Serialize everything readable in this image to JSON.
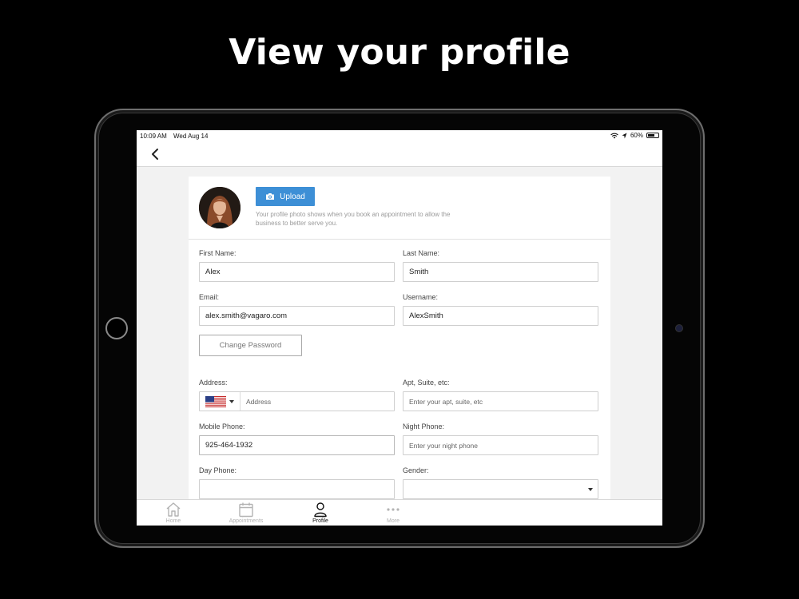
{
  "headline": "View your profile",
  "status_bar": {
    "time": "10:09 AM",
    "date": "Wed Aug 14",
    "battery": "60%"
  },
  "profile_photo": {
    "upload_label": "Upload",
    "hint": "Your profile photo shows when you book an appointment to allow the business to better serve you."
  },
  "form": {
    "first_name": {
      "label": "First Name:",
      "value": "Alex"
    },
    "last_name": {
      "label": "Last Name:",
      "value": "Smith"
    },
    "email": {
      "label": "Email:",
      "value": "alex.smith@vagaro.com"
    },
    "username": {
      "label": "Username:",
      "value": "AlexSmith"
    },
    "change_password": "Change Password",
    "address": {
      "label": "Address:",
      "placeholder": "Address"
    },
    "apt": {
      "label": "Apt, Suite, etc:",
      "placeholder": "Enter your apt, suite, etc"
    },
    "mobile_phone": {
      "label": "Mobile Phone:",
      "value": "925-464-1932"
    },
    "night_phone": {
      "label": "Night Phone:",
      "placeholder": "Enter your night phone"
    },
    "day_phone": {
      "label": "Day Phone:",
      "value": ""
    },
    "gender": {
      "label": "Gender:",
      "value": ""
    }
  },
  "tabs": [
    {
      "label": "Home",
      "icon": "home-icon",
      "active": false
    },
    {
      "label": "Appointments",
      "icon": "calendar-icon",
      "active": false
    },
    {
      "label": "Profile",
      "icon": "person-icon",
      "active": true
    },
    {
      "label": "More",
      "icon": "more-icon",
      "active": false
    }
  ]
}
